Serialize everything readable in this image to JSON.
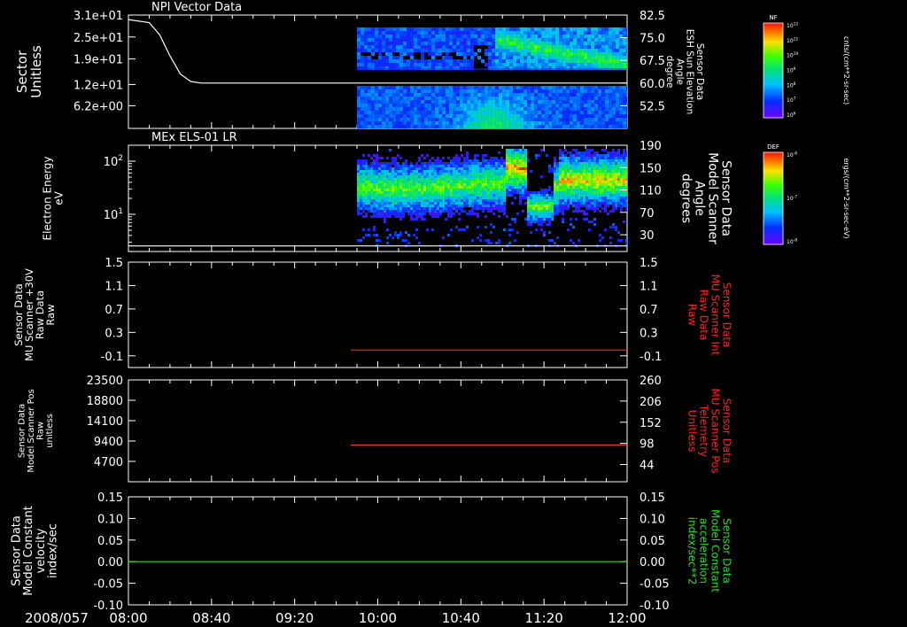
{
  "time_axis": {
    "date_label": "2008/057",
    "range_minutes": [
      480,
      720
    ],
    "ticks": [
      {
        "t": 480,
        "label": "08:00"
      },
      {
        "t": 520,
        "label": "08:40"
      },
      {
        "t": 560,
        "label": "09:20"
      },
      {
        "t": 600,
        "label": "10:00"
      },
      {
        "t": 640,
        "label": "10:40"
      },
      {
        "t": 680,
        "label": "11:20"
      },
      {
        "t": 720,
        "label": "12:00"
      }
    ]
  },
  "colorbars": [
    {
      "label": "NF",
      "units": "cnts/(cm**2-sr-sec)",
      "tick_labels": [
        "10^12",
        "10^11",
        "10^10",
        "10^9",
        "10^8",
        "10^7",
        "10^6"
      ]
    },
    {
      "label": "DEF",
      "units": "ergs/(cm**2-sr-sec-eV)",
      "tick_labels": [
        "10^-6",
        "10^-7",
        "10^-8"
      ]
    }
  ],
  "colors": {
    "red": "#ff2020",
    "green": "#20e020",
    "white": "#ffffff",
    "axis": "#ffffff"
  },
  "chart_data": [
    {
      "type": "heatmap",
      "title": "NPI Vector Data",
      "left_label": [
        "Sector",
        "Unitless"
      ],
      "left_ticks": [
        "3.1e+01",
        "2.5e+01",
        "1.9e+01",
        "1.2e+01",
        "6.2e+00"
      ],
      "left_tick_values": [
        31,
        25,
        19,
        12,
        6.2
      ],
      "ylim": [
        0,
        31
      ],
      "right_label": [
        "Sensor Data",
        "ESH Sun Elevation",
        "Angle",
        "degree"
      ],
      "right_ticks": [
        "82.5",
        "75.0",
        "67.5",
        "60.0",
        "52.5"
      ],
      "right_tick_values": [
        82.5,
        75.0,
        67.5,
        60.0,
        52.5
      ],
      "right_ylim": [
        45,
        82.5
      ],
      "spectrogram_start": 590,
      "line_series": {
        "t": [
          480,
          490,
          495,
          500,
          505,
          510,
          515,
          520,
          720
        ],
        "y": [
          81,
          80,
          76,
          69,
          63,
          60.5,
          60,
          60,
          60
        ]
      }
    },
    {
      "type": "heatmap",
      "title": "MEx ELS-01 LR",
      "left_label": [
        "Electron Energy",
        "eV"
      ],
      "left_ticks": [
        "10^2",
        "10^1"
      ],
      "left_log_range": [
        0.3,
        2.3
      ],
      "right_label": [
        "Sensor Data",
        "Model Scanner",
        "Angle",
        "degrees"
      ],
      "right_ticks": [
        "190",
        "150",
        "110",
        "70",
        "30"
      ],
      "right_tick_values": [
        190,
        150,
        110,
        70,
        30
      ],
      "right_ylim": [
        0,
        190
      ],
      "spectrogram_start": 590,
      "line_series": {
        "t": [
          480,
          720
        ],
        "y": [
          10,
          10
        ]
      }
    },
    {
      "type": "line",
      "left_label": [
        "Sensor Data",
        "MU Scanner +30V",
        "Raw Data",
        "Raw"
      ],
      "left_ticks": [
        "1.5",
        "1.1",
        "0.7",
        "0.3",
        "-0.1"
      ],
      "left_tick_values": [
        1.5,
        1.1,
        0.7,
        0.3,
        -0.1
      ],
      "ylim": [
        -0.3,
        1.5
      ],
      "right_label": [
        "Sensor Data",
        "MU Scanner Int",
        "Raw Data",
        "Raw"
      ],
      "right_ticks": [
        "1.5",
        "1.1",
        "0.7",
        "0.3",
        "-0.1"
      ],
      "series": [
        {
          "t": [
            587,
            720
          ],
          "y": [
            0.0,
            0.0
          ],
          "color": "red"
        }
      ]
    },
    {
      "type": "line",
      "left_label": [
        "Sensor Data",
        "Model Scanner Pos",
        "Raw",
        "unitless"
      ],
      "left_ticks": [
        "23500",
        "18800",
        "14100",
        "9400",
        "4700"
      ],
      "left_tick_values": [
        23500,
        18800,
        14100,
        9400,
        4700
      ],
      "ylim": [
        0,
        23500
      ],
      "right_label": [
        "Sensor Data",
        "MU Scanner Pos",
        "Telemetry",
        "Unitless"
      ],
      "right_ticks": [
        "260",
        "206",
        "152",
        "98",
        "44"
      ],
      "right_tick_values": [
        260,
        206,
        152,
        98,
        44
      ],
      "right_ylim": [
        0,
        260
      ],
      "series": [
        {
          "t": [
            587,
            720
          ],
          "y": [
            8500,
            8500
          ],
          "color": "red"
        }
      ]
    },
    {
      "type": "line",
      "left_label": [
        "Sensor Data",
        "Model Constant",
        "velocity",
        "index/sec"
      ],
      "left_ticks": [
        "0.15",
        "0.10",
        "0.05",
        "0.00",
        "-0.05",
        "-0.10"
      ],
      "left_tick_values": [
        0.15,
        0.1,
        0.05,
        0.0,
        -0.05,
        -0.1
      ],
      "ylim": [
        -0.1,
        0.15
      ],
      "right_label": [
        "Sensor Data",
        "Model Constant",
        "acceleration",
        "index/sec**2"
      ],
      "right_ticks": [
        "0.15",
        "0.10",
        "0.05",
        "0.00",
        "-0.05",
        "-0.10"
      ],
      "series": [
        {
          "t": [
            480,
            720
          ],
          "y": [
            0.0,
            0.0
          ],
          "color": "green"
        }
      ]
    }
  ]
}
